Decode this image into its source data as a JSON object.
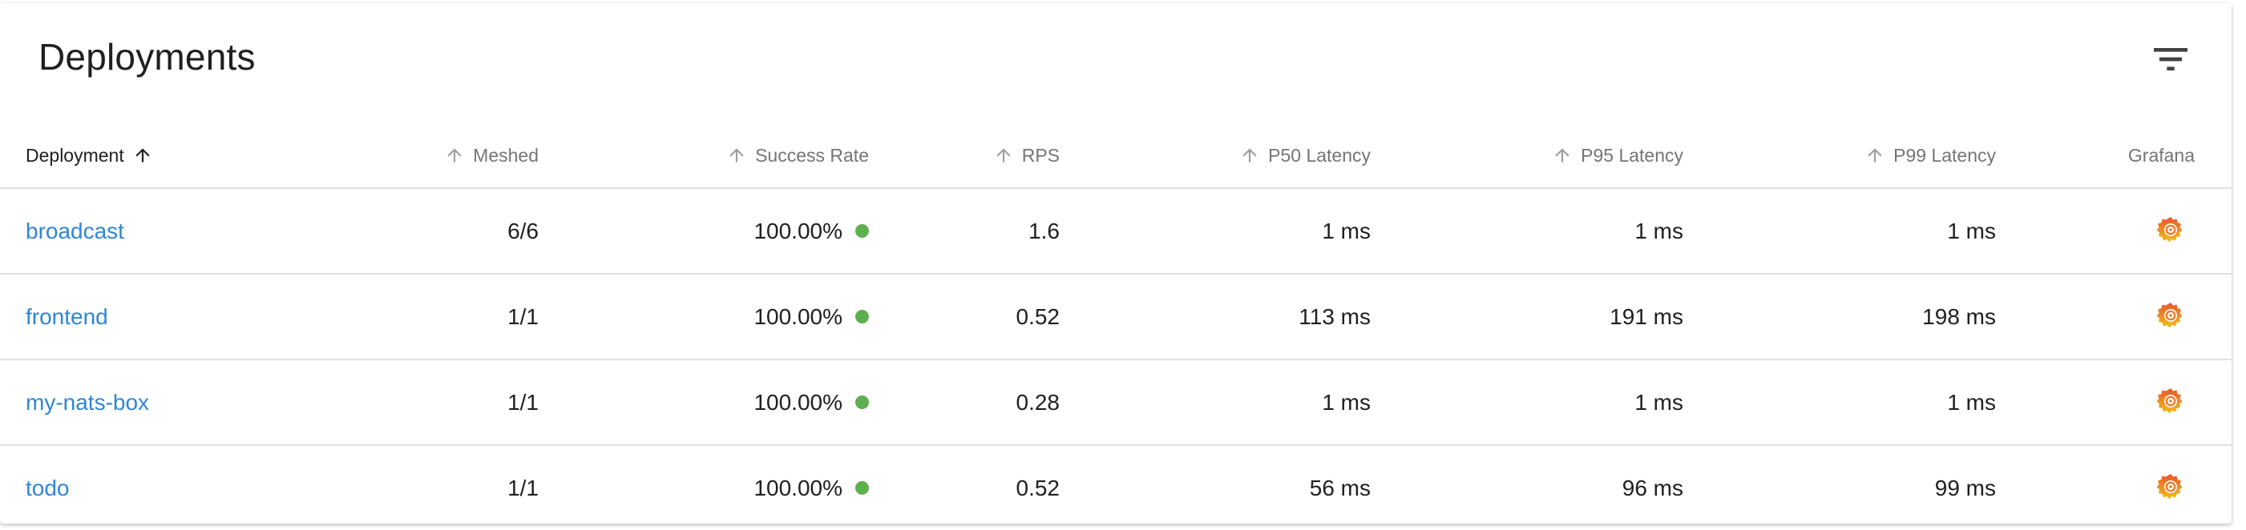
{
  "card": {
    "title": "Deployments",
    "filter_icon": "filter-list-icon"
  },
  "table": {
    "columns": {
      "deployment": "Deployment",
      "meshed": "Meshed",
      "success_rate": "Success Rate",
      "rps": "RPS",
      "p50": "P50 Latency",
      "p95": "P95 Latency",
      "p99": "P99 Latency",
      "grafana": "Grafana"
    },
    "sort_icon": "arrow-up-icon",
    "status_color": "#5eaf4f",
    "link_color": "#2f86d6",
    "grafana_icon": "grafana-icon",
    "rows": [
      {
        "name": "broadcast",
        "meshed": "6/6",
        "success_rate": "100.00%",
        "rps": "1.6",
        "p50": "1 ms",
        "p95": "1 ms",
        "p99": "1 ms"
      },
      {
        "name": "frontend",
        "meshed": "1/1",
        "success_rate": "100.00%",
        "rps": "0.52",
        "p50": "113 ms",
        "p95": "191 ms",
        "p99": "198 ms"
      },
      {
        "name": "my-nats-box",
        "meshed": "1/1",
        "success_rate": "100.00%",
        "rps": "0.28",
        "p50": "1 ms",
        "p95": "1 ms",
        "p99": "1 ms"
      },
      {
        "name": "todo",
        "meshed": "1/1",
        "success_rate": "100.00%",
        "rps": "0.52",
        "p50": "56 ms",
        "p95": "96 ms",
        "p99": "99 ms"
      }
    ]
  }
}
